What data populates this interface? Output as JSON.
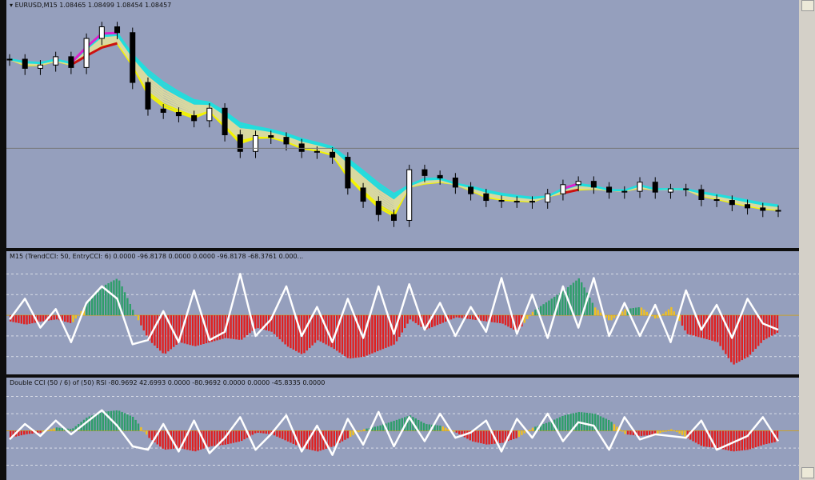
{
  "panes": {
    "main": {
      "label_prefix": "▾ ",
      "label": "EURUSD,M15  1.08465 1.08499 1.08454 1.08457"
    },
    "cci1": {
      "label": "M15 (TrendCCI: 50, EntryCCI: 6)  0.0000 -96.8178 0.0000 0.0000 -96.8178 -68.3761 0.000..."
    },
    "cci2": {
      "label": "Double CCI (50 / 6) of (50) RSI -80.9692 42.6993 0.0000 -80.9692 0.0000 0.0000 -45.8335 0.0000"
    }
  },
  "colors": {
    "background": "#959fbd",
    "bull_hist": "#2e9e6a",
    "bear_hist": "#e02020",
    "signal_line": "#ffffff",
    "transition_hist": "#f0c020",
    "ribbon_upper": "#22dddd",
    "ribbon_lower": "#f5f500",
    "ribbon_red": "#cc1111",
    "ribbon_magenta": "#dd22cc",
    "candles": "#000000"
  },
  "chart_data": [
    {
      "type": "line",
      "symbol": "EURUSD",
      "timeframe": "M15",
      "last_ohlc": {
        "open": 1.08465,
        "high": 1.08499,
        "low": 1.08454,
        "close": 1.08457
      },
      "x": [
        0,
        1,
        2,
        3,
        4,
        5,
        6,
        7,
        8,
        9,
        10,
        11,
        12,
        13,
        14,
        15,
        16,
        17,
        18,
        19,
        20,
        21,
        22,
        23,
        24,
        25,
        26,
        27,
        28,
        29,
        30,
        31,
        32,
        33,
        34,
        35,
        36,
        37,
        38,
        39,
        40,
        41,
        42,
        43,
        44,
        45,
        46,
        47,
        48,
        49,
        50
      ],
      "series": [
        {
          "values": [
            1.0953,
            1.0942,
            1.0946,
            1.0956,
            1.0943,
            1.0978,
            1.0992,
            1.0985,
            1.0925,
            1.0893,
            1.0889,
            1.0885,
            1.0879,
            1.0894,
            1.0862,
            1.0842,
            1.0861,
            1.0859,
            1.0851,
            1.0842,
            1.0841,
            1.0835,
            1.0798,
            1.0782,
            1.0766,
            1.0759,
            1.082,
            1.0813,
            1.081,
            1.0799,
            1.0791,
            1.0783,
            1.0782,
            1.0782,
            1.0781,
            1.0791,
            1.0802,
            1.0806,
            1.0799,
            1.0793,
            1.0794,
            1.0805,
            1.0793,
            1.0797,
            1.0796,
            1.0784,
            1.0783,
            1.0778,
            1.0774,
            1.0771,
            1.0771
          ]
        }
      ]
    },
    {
      "type": "bar",
      "x": [
        0,
        1,
        2,
        3,
        4,
        5,
        6,
        7,
        8,
        9,
        10,
        11,
        12,
        13,
        14,
        15,
        16,
        17,
        18,
        19,
        20,
        21,
        22,
        23,
        24,
        25,
        26,
        27,
        28,
        29,
        30,
        31,
        32,
        33,
        34,
        35,
        36,
        37,
        38,
        39,
        40,
        41,
        42,
        43,
        44,
        45,
        46,
        47,
        48,
        49,
        50
      ],
      "series": [
        {
          "values": [
            -30,
            -45,
            -30,
            -20,
            -40,
            60,
            140,
            180,
            20,
            -120,
            -190,
            -130,
            -150,
            -130,
            -110,
            -120,
            -60,
            -80,
            -150,
            -190,
            -120,
            -160,
            -210,
            -200,
            -170,
            -140,
            -20,
            -70,
            -40,
            -10,
            -20,
            -30,
            -40,
            -80,
            20,
            70,
            120,
            180,
            40,
            -30,
            30,
            40,
            -20,
            40,
            -90,
            -110,
            -130,
            -240,
            -200,
            -120,
            -80
          ]
        },
        {
          "values": [
            -20,
            80,
            -60,
            30,
            -130,
            60,
            140,
            80,
            -140,
            -120,
            20,
            -130,
            120,
            -120,
            -80,
            200,
            -100,
            -20,
            140,
            -100,
            40,
            -130,
            80,
            -110,
            140,
            -90,
            150,
            -70,
            60,
            -100,
            40,
            -80,
            180,
            -90,
            100,
            -110,
            140,
            -60,
            180,
            -100,
            60,
            -100,
            50,
            -130,
            120,
            -70,
            50,
            -110,
            80,
            -40,
            -70
          ]
        }
      ]
    },
    {
      "type": "bar",
      "x": [
        0,
        1,
        2,
        3,
        4,
        5,
        6,
        7,
        8,
        9,
        10,
        11,
        12,
        13,
        14,
        15,
        16,
        17,
        18,
        19,
        20,
        21,
        22,
        23,
        24,
        25,
        26,
        27,
        28,
        29,
        30,
        31,
        32,
        33,
        34,
        35,
        36,
        37,
        38,
        39,
        40,
        41,
        42,
        43,
        44,
        45,
        46,
        47,
        48,
        49,
        50
      ],
      "series": [
        {
          "values": [
            -40,
            -20,
            -10,
            20,
            10,
            80,
            110,
            120,
            80,
            -40,
            -110,
            -100,
            -120,
            -90,
            -80,
            -60,
            -10,
            -20,
            -60,
            -100,
            -120,
            -90,
            -40,
            10,
            30,
            60,
            90,
            40,
            30,
            -10,
            -60,
            -80,
            -70,
            -40,
            20,
            50,
            90,
            110,
            100,
            60,
            -20,
            -30,
            -20,
            10,
            -40,
            -90,
            -100,
            -120,
            -110,
            -80,
            -60
          ]
        },
        {
          "values": [
            -50,
            40,
            -30,
            60,
            -20,
            50,
            120,
            30,
            -90,
            -110,
            40,
            -120,
            60,
            -130,
            -40,
            80,
            -110,
            -20,
            90,
            -120,
            30,
            -140,
            70,
            -80,
            110,
            -90,
            80,
            -60,
            100,
            -40,
            -10,
            60,
            -120,
            70,
            -40,
            100,
            -60,
            50,
            30,
            -110,
            80,
            -50,
            -20,
            -30,
            -40,
            60,
            -110,
            -70,
            -30,
            80,
            -60
          ]
        }
      ]
    }
  ]
}
